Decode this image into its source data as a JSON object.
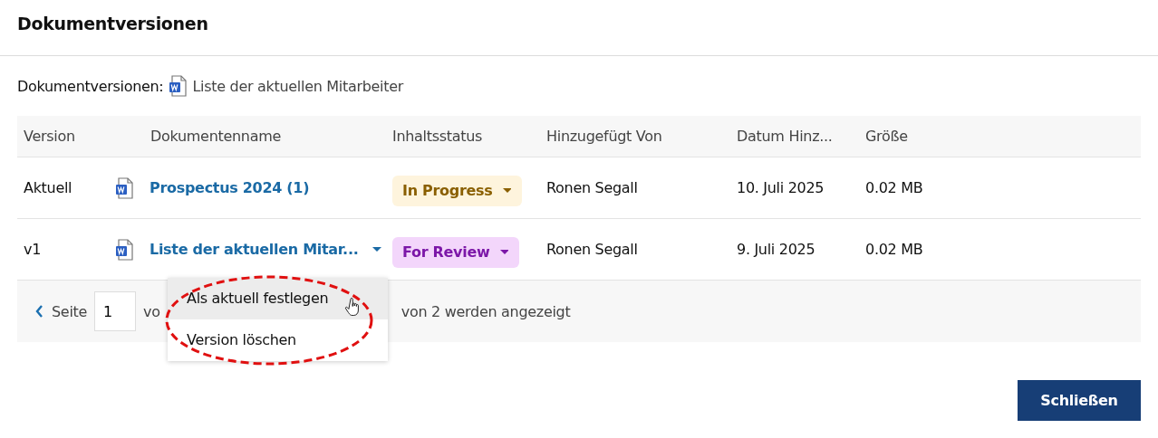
{
  "dialog": {
    "title": "Dokumentversionen"
  },
  "subtitle": {
    "label": "Dokumentversionen:",
    "document": "Liste der aktuellen Mitarbeiter"
  },
  "table": {
    "columns": [
      "Version",
      "Dokumentenname",
      "Inhaltsstatus",
      "Hinzugefügt Von",
      "Datum Hinz...",
      "Größe"
    ],
    "rows": [
      {
        "version": "Aktuell",
        "name": "Prospectus 2024 (1)",
        "menu_button": false,
        "status": {
          "label": "In Progress",
          "kind": "progress"
        },
        "added_by": "Ronen Segall",
        "date": "10. Juli 2025",
        "size": "0.02 MB"
      },
      {
        "version": "v1",
        "name": "Liste der aktuellen Mitar...",
        "menu_button": true,
        "status": {
          "label": "For Review",
          "kind": "review"
        },
        "added_by": "Ronen Segall",
        "date": "9. Juli 2025",
        "size": "0.02 MB"
      }
    ]
  },
  "pagination": {
    "page_label": "Seite",
    "page": "1",
    "text_before_menu": "vo",
    "text_after_menu": "von 2 werden angezeigt"
  },
  "context_menu": {
    "items": [
      {
        "label": "Als aktuell festlegen",
        "selected": true
      },
      {
        "label": "Version löschen",
        "selected": false
      }
    ]
  },
  "highlight": {
    "kind": "dashed-ellipse"
  },
  "buttons": [
    "Schließen"
  ]
}
